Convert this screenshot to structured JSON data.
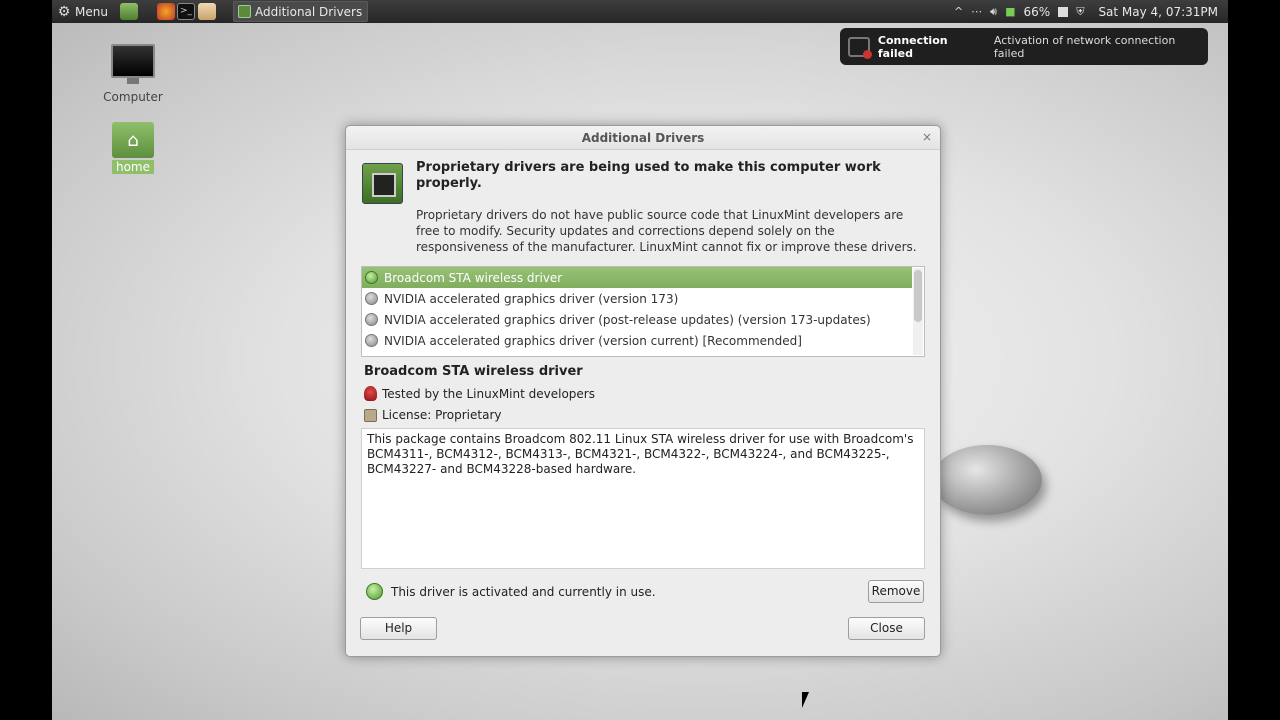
{
  "panel": {
    "menu_label": "Menu",
    "task_label": "Additional Drivers",
    "battery": "66%",
    "clock": "Sat May  4, 07:31PM"
  },
  "notification": {
    "title": "Connection failed",
    "body": "Activation of network connection failed"
  },
  "desktop": {
    "computer_label": "Computer",
    "home_label": "home"
  },
  "dialog": {
    "title": "Additional Drivers",
    "header": "Proprietary drivers are being used to make this computer work properly.",
    "description": "Proprietary drivers do not have public source code that LinuxMint developers are free to modify. Security updates and corrections depend solely on the responsiveness of the manufacturer. LinuxMint cannot fix or improve these drivers.",
    "drivers": [
      {
        "label": "Broadcom STA wireless driver",
        "selected": true
      },
      {
        "label": "NVIDIA accelerated graphics driver (version 173)",
        "selected": false
      },
      {
        "label": "NVIDIA accelerated graphics driver (post-release updates) (version 173-updates)",
        "selected": false
      },
      {
        "label": "NVIDIA accelerated graphics driver (version current) [Recommended]",
        "selected": false
      }
    ],
    "detail_title": "Broadcom STA wireless driver",
    "tested_by": "Tested by the LinuxMint developers",
    "license": "License: Proprietary",
    "package_description": " This package contains Broadcom 802.11 Linux STA wireless driver for use with Broadcom's BCM4311-, BCM4312-, BCM4313-, BCM4321-, BCM4322-, BCM43224-, and BCM43225-, BCM43227- and BCM43228-based hardware.",
    "status": "This driver is activated and currently in use.",
    "remove_label": "Remove",
    "help_label": "Help",
    "close_label": "Close",
    "close_glyph": "×"
  },
  "icons": {
    "menu": "gear-icon",
    "network": "network-icon",
    "volume": "volume-icon",
    "battery": "battery-icon",
    "shield": "shield-icon",
    "expand": "chevron-up-icon"
  }
}
